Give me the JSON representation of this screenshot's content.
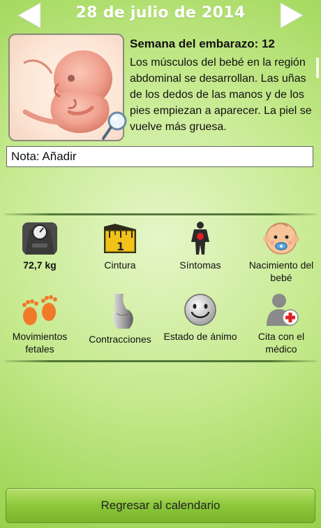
{
  "header": {
    "date": "28 de julio de 2014"
  },
  "week": {
    "title": "Semana del embarazo: 12",
    "description": "Los músculos del bebé en la región abdominal se desarrollan. Las uñas de los dedos de las manos y de los pies empiezan a aparecer. La piel se vuelve más gruesa."
  },
  "note": {
    "label": "Nota: Añadir"
  },
  "items": [
    {
      "label": "72,7 kg",
      "icon": "scale-icon"
    },
    {
      "label": "Cintura",
      "icon": "tape-measure-icon"
    },
    {
      "label": "Síntomas",
      "icon": "body-symptoms-icon"
    },
    {
      "label": "Nacimiento del bebé",
      "icon": "baby-face-icon"
    },
    {
      "label": "Movimientos fetales",
      "icon": "footprints-icon"
    },
    {
      "label": "Contracciones",
      "icon": "pregnant-belly-icon"
    },
    {
      "label": "Estado de ánimo",
      "icon": "smiley-icon"
    },
    {
      "label": "Cita con el médico",
      "icon": "doctor-appointment-icon"
    }
  ],
  "footer": {
    "button": "Regresar al calendario"
  },
  "colors": {
    "background": "#c4e98c",
    "button": "#8cc83a",
    "arrow": "#ffffff"
  }
}
